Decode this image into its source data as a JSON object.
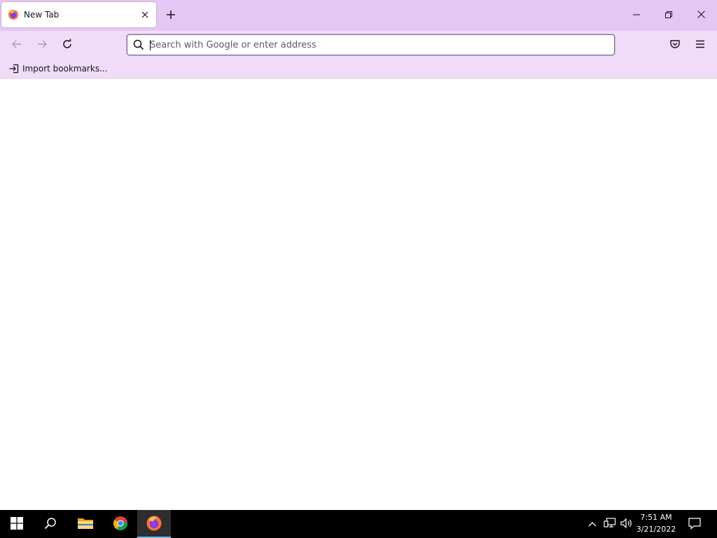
{
  "browser": {
    "tab": {
      "title": "New Tab"
    },
    "urlbar": {
      "placeholder": "Search with Google or enter address",
      "value": ""
    },
    "bookmarks": [
      {
        "label": "Import bookmarks..."
      }
    ]
  },
  "colors": {
    "tabbar_bg": "#e6c6f2",
    "toolbar_bg": "#f0dcf8",
    "taskbar_bg": "#000000",
    "taskbar_active_indicator": "#76b9ed"
  },
  "icons": {
    "tab_favicon": "firefox-icon",
    "tab_close": "close-icon",
    "new_tab": "plus-icon",
    "window_controls": [
      "minimize-icon",
      "restore-icon",
      "close-icon"
    ],
    "nav": [
      "back-arrow-icon",
      "forward-arrow-icon",
      "reload-icon"
    ],
    "toolbar_right": [
      "pocket-icon",
      "hamburger-menu-icon"
    ],
    "taskbar_apps": [
      "windows-start-icon",
      "search-icon",
      "file-explorer-icon",
      "chrome-icon",
      "firefox-icon"
    ],
    "tray": [
      "chevron-up-icon",
      "network-icon",
      "volume-icon",
      "notification-icon"
    ]
  },
  "taskbar": {
    "time": "7:51 AM",
    "date": "3/21/2022",
    "active_app": "firefox"
  }
}
